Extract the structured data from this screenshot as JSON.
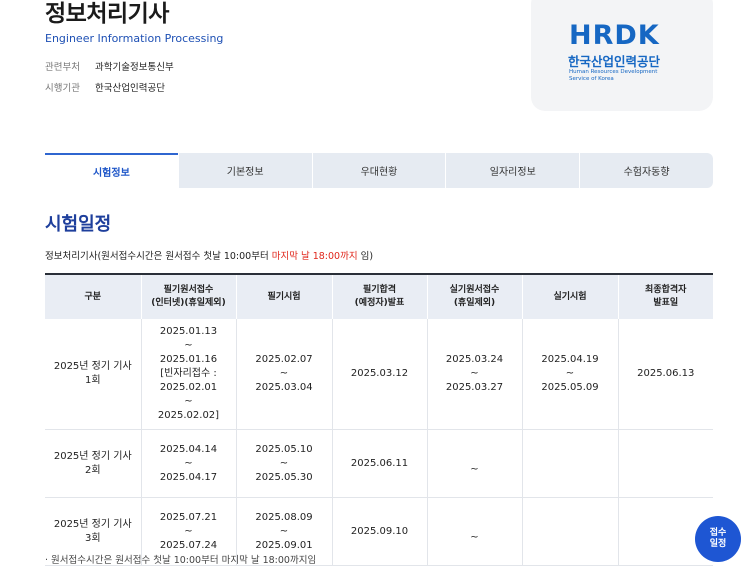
{
  "header": {
    "title": "정보처리기사",
    "subtitle": "Engineer Information Processing",
    "ministry_key": "관련부처",
    "ministry_value": "과학기술정보통신부",
    "agency_key": "시행기관",
    "agency_value": "한국산업인력공단"
  },
  "logo": {
    "mark": "HRDK",
    "korean": "한국산업인력공단",
    "english_line1": "Human Resources Development",
    "english_line2": "Service of Korea",
    "color": "#1667c3"
  },
  "tabs": [
    {
      "label": "시험정보",
      "active": true
    },
    {
      "label": "기본정보",
      "active": false
    },
    {
      "label": "우대현황",
      "active": false
    },
    {
      "label": "일자리정보",
      "active": false
    },
    {
      "label": "수험자동향",
      "active": false
    }
  ],
  "section": {
    "title": "시험일정",
    "notice_prefix": "정보처리기사(원서접수시간은 원서접수 첫날 10:00부터 ",
    "notice_red": "마지막 날 18:00까지",
    "notice_suffix": " 임)"
  },
  "table": {
    "headers": [
      "구분",
      "필기원서접수\n(인터넷)(휴일제외)",
      "필기시험",
      "필기합격\n(예정자)발표",
      "실기원서접수\n(휴일제외)",
      "실기시험",
      "최종합격자\n발표일"
    ],
    "rows": [
      [
        "2025년 정기 기사\n1회",
        "2025.01.13\n~\n2025.01.16\n[빈자리접수 :\n2025.02.01\n~\n2025.02.02]",
        "2025.02.07\n~\n2025.03.04",
        "2025.03.12",
        "2025.03.24\n~\n2025.03.27",
        "2025.04.19\n~\n2025.05.09",
        "2025.06.13"
      ],
      [
        "2025년 정기 기사\n2회",
        "2025.04.14\n~\n2025.04.17",
        "2025.05.10\n~\n2025.05.30",
        "2025.06.11",
        "~",
        "",
        ""
      ],
      [
        "2025년 정기 기사\n3회",
        "2025.07.21\n~\n2025.07.24",
        "2025.08.09\n~\n2025.09.01",
        "2025.09.10",
        "~",
        "",
        ""
      ]
    ]
  },
  "footnote": "· 원서접수시간은 원서접수 첫날 10:00부터 마지막 날 18:00까지임",
  "apply_button": {
    "line1": "접수",
    "line2": "일정"
  },
  "colors": {
    "accent": "#1e56c8",
    "title_blue": "#1e3f9c",
    "notice_red": "#e0261b"
  }
}
